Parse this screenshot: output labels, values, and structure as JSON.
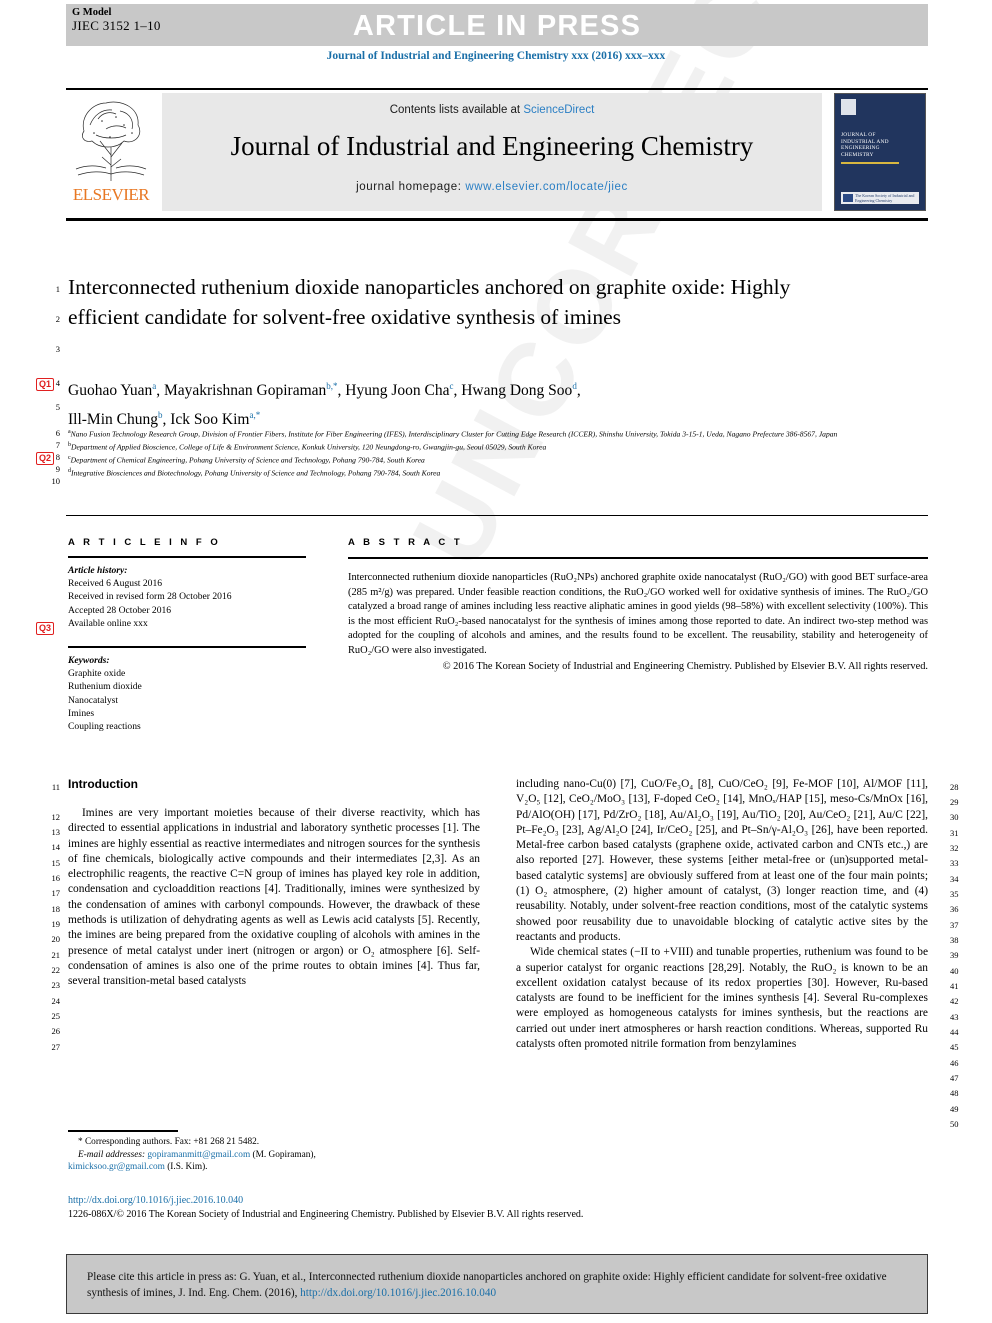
{
  "header": {
    "gmodel_label": "G Model",
    "article_id": "JIEC 3152 1–10",
    "article_in_press": "ARTICLE IN PRESS",
    "journal_running_head": "Journal of Industrial and Engineering Chemistry xxx (2016) xxx–xxx"
  },
  "masthead": {
    "contents_prefix": "Contents lists available at ",
    "contents_link": "ScienceDirect",
    "journal_title": "Journal of Industrial and Engineering Chemistry",
    "homepage_prefix": "journal homepage: ",
    "homepage_link": "www.elsevier.com/locate/jiec",
    "publisher": "ELSEVIER",
    "cover_title": "JOURNAL OF INDUSTRIAL AND ENGINEERING CHEMISTRY",
    "cover_footer": "The Korean Society of Industrial and Engineering Chemistry"
  },
  "article": {
    "title": "Interconnected ruthenium dioxide nanoparticles anchored on graphite oxide: Highly efficient candidate for solvent-free oxidative synthesis of imines",
    "authors": [
      {
        "name": "Guohao Yuan",
        "sup": "a"
      },
      {
        "name": "Mayakrishnan Gopiraman",
        "sup": "b,*"
      },
      {
        "name": "Hyung Joon Cha",
        "sup": "c"
      },
      {
        "name": "Hwang Dong Soo",
        "sup": "d"
      },
      {
        "name": "Ill-Min Chung",
        "sup": "b"
      },
      {
        "name": "Ick Soo Kim",
        "sup": "a,*"
      }
    ],
    "affiliations": [
      {
        "sup": "a",
        "text": "Nano Fusion Technology Research Group, Division of Frontier Fibers, Institute for Fiber Engineering (IFES), Interdisciplinary Cluster for Cutting Edge Research (ICCER), Shinshu University, Tokida 3-15-1, Ueda, Nagano Prefecture 386-8567, Japan"
      },
      {
        "sup": "b",
        "text": "Department of Applied Bioscience, College of Life & Environment Science, Konkuk University, 120 Neungdong-ro, Gwangjin-gu, Seoul 05029, South Korea"
      },
      {
        "sup": "c",
        "text": "Department of Chemical Engineering, Pohang University of Science and Technology, Pohang 790-784, South Korea"
      },
      {
        "sup": "d",
        "text": "Integrative Biosciences and Biotechnology, Pohang University of Science and Technology, Pohang 790-784, South Korea"
      }
    ]
  },
  "article_info": {
    "heading": "A R T I C L E  I N F O",
    "history_label": "Article history:",
    "history": [
      "Received 6 August 2016",
      "Received in revised form 28 October 2016",
      "Accepted 28 October 2016",
      "Available online xxx"
    ],
    "keywords_label": "Keywords:",
    "keywords": [
      "Graphite oxide",
      "Ruthenium dioxide",
      "Nanocatalyst",
      "Imines",
      "Coupling reactions"
    ]
  },
  "abstract": {
    "heading": "A B S T R A C T",
    "body": "Interconnected ruthenium dioxide nanoparticles (RuO₂NPs) anchored graphite oxide nanocatalyst (RuO₂/GO) with good BET surface-area (285 m²/g) was prepared. Under feasible reaction conditions, the RuO₂/GO worked well for oxidative synthesis of imines. The RuO₂/GO catalyzed a broad range of amines including less reactive aliphatic amines in good yields (98–58%) with excellent selectivity (100%). This is the most efficient RuO₂-based nanocatalyst for the synthesis of imines among those reported to date. An indirect two-step method was adopted for the coupling of alcohols and amines, and the results found to be excellent. The reusability, stability and heterogeneity of RuO₂/GO were also investigated.",
    "copyright": "© 2016 The Korean Society of Industrial and Engineering Chemistry. Published by Elsevier B.V. All rights reserved."
  },
  "introduction": {
    "heading": "Introduction",
    "left_paragraph": "Imines are very important moieties because of their diverse reactivity, which has directed to essential applications in industrial and laboratory synthetic processes [1]. The imines are highly essential as reactive intermediates and nitrogen sources for the synthesis of fine chemicals, biologically active compounds and their intermediates [2,3]. As an electrophilic reagents, the reactive C=N group of imines has played key role in addition, condensation and cycloaddition reactions [4]. Traditionally, imines were synthesized by the condensation of amines with carbonyl compounds. However, the drawback of these methods is utilization of dehydrating agents as well as Lewis acid catalysts [5]. Recently, the imines are being prepared from the oxidative coupling of alcohols with amines in the presence of metal catalyst under inert (nitrogen or argon) or O₂ atmosphere [6]. Self-condensation of amines is also one of the prime routes to obtain imines [4]. Thus far, several transition-metal based catalysts",
    "right_paragraph_1": "including nano-Cu(0) [7], CuO/Fe₃O₄ [8], CuO/CeO₂ [9], Fe-MOF [10], Al/MOF [11], V₂O₅ [12], CeO₂/MoO₃ [13], F-doped CeO₂ [14], MnOₓ/HAP [15], meso-Cs/MnOx [16], Pd/AlO(OH) [17], Pd/ZrO₂ [18], Au/Al₂O₃ [19], Au/TiO₂ [20], Au/CeO₂ [21], Au/C [22], Pt–Fe₂O₃ [23], Ag/Al₂O [24], Ir/CeO₂ [25], and Pt–Sn/γ-Al₂O₃ [26], have been reported. Metal-free carbon based catalysts (graphene oxide, activated carbon and CNTs etc.,) are also reported [27]. However, these systems [either metal-free or (un)supported metal-based catalytic systems] are obviously suffered from at least one of the four main points; (1) O₂ atmosphere, (2) higher amount of catalyst, (3) longer reaction time, and (4) reusability. Notably, under solvent-free reaction conditions, most of the catalytic systems showed poor reusability due to unavoidable blocking of catalytic active sites by the reactants and products.",
    "right_paragraph_2": "Wide chemical states (−II to +VIII) and tunable properties, ruthenium was found to be a superior catalyst for organic reactions [28,29]. Notably, the RuO₂ is known to be an excellent oxidation catalyst because of its redox properties [30]. However, Ru-based catalysts are found to be inefficient for the imines synthesis [4]. Several Ru-complexes were employed as homogeneous catalysts for imines synthesis, but the reactions are carried out under inert atmospheres or harsh reaction conditions. Whereas, supported Ru catalysts often promoted nitrile formation from benzylamines"
  },
  "footnotes": {
    "corresponding": "* Corresponding authors. Fax: +81 268 21 5482.",
    "email_label": "E-mail addresses:",
    "email_1": "gopiramanmitt@gmail.com",
    "email_1_owner": "(M. Gopiraman),",
    "email_2": "kimicksoo.gr@gmail.com",
    "email_2_owner": "(I.S. Kim).",
    "doi_url": "http://dx.doi.org/10.1016/j.jiec.2016.10.040",
    "copyright_line": "1226-086X/© 2016 The Korean Society of Industrial and Engineering Chemistry. Published by Elsevier B.V. All rights reserved."
  },
  "cite_box": {
    "text_part_1": "Please cite this article in press as: G. Yuan, et al., Interconnected ruthenium dioxide nanoparticles anchored on graphite oxide: Highly efficient candidate for solvent-free oxidative synthesis of imines, J. Ind. Eng. Chem. (2016), ",
    "link": "http://dx.doi.org/10.1016/j.jiec.2016.10.040"
  },
  "markers": {
    "q1": "Q1",
    "q2": "Q2",
    "q3": "Q3"
  },
  "line_numbers_left": [
    "1",
    "2",
    "3",
    "4",
    "5",
    "6",
    "7",
    "8",
    "9",
    "10",
    "11",
    "12",
    "13",
    "14",
    "15",
    "16",
    "17",
    "18",
    "19",
    "20",
    "21",
    "22",
    "23",
    "24",
    "25",
    "26",
    "27"
  ],
  "line_numbers_right": [
    "28",
    "29",
    "30",
    "31",
    "32",
    "33",
    "34",
    "35",
    "36",
    "37",
    "38",
    "39",
    "40",
    "41",
    "42",
    "43",
    "44",
    "45",
    "46",
    "47",
    "48",
    "49",
    "50"
  ],
  "watermark_text": "UNCORRECTED PROOF",
  "colors": {
    "link": "#1a6fa8",
    "marker": "#e02020",
    "banner": "#c8c8c8",
    "masthead_bg": "#e8e8e8",
    "elsevier_orange": "#e87722",
    "cover_navy": "#21355e"
  }
}
